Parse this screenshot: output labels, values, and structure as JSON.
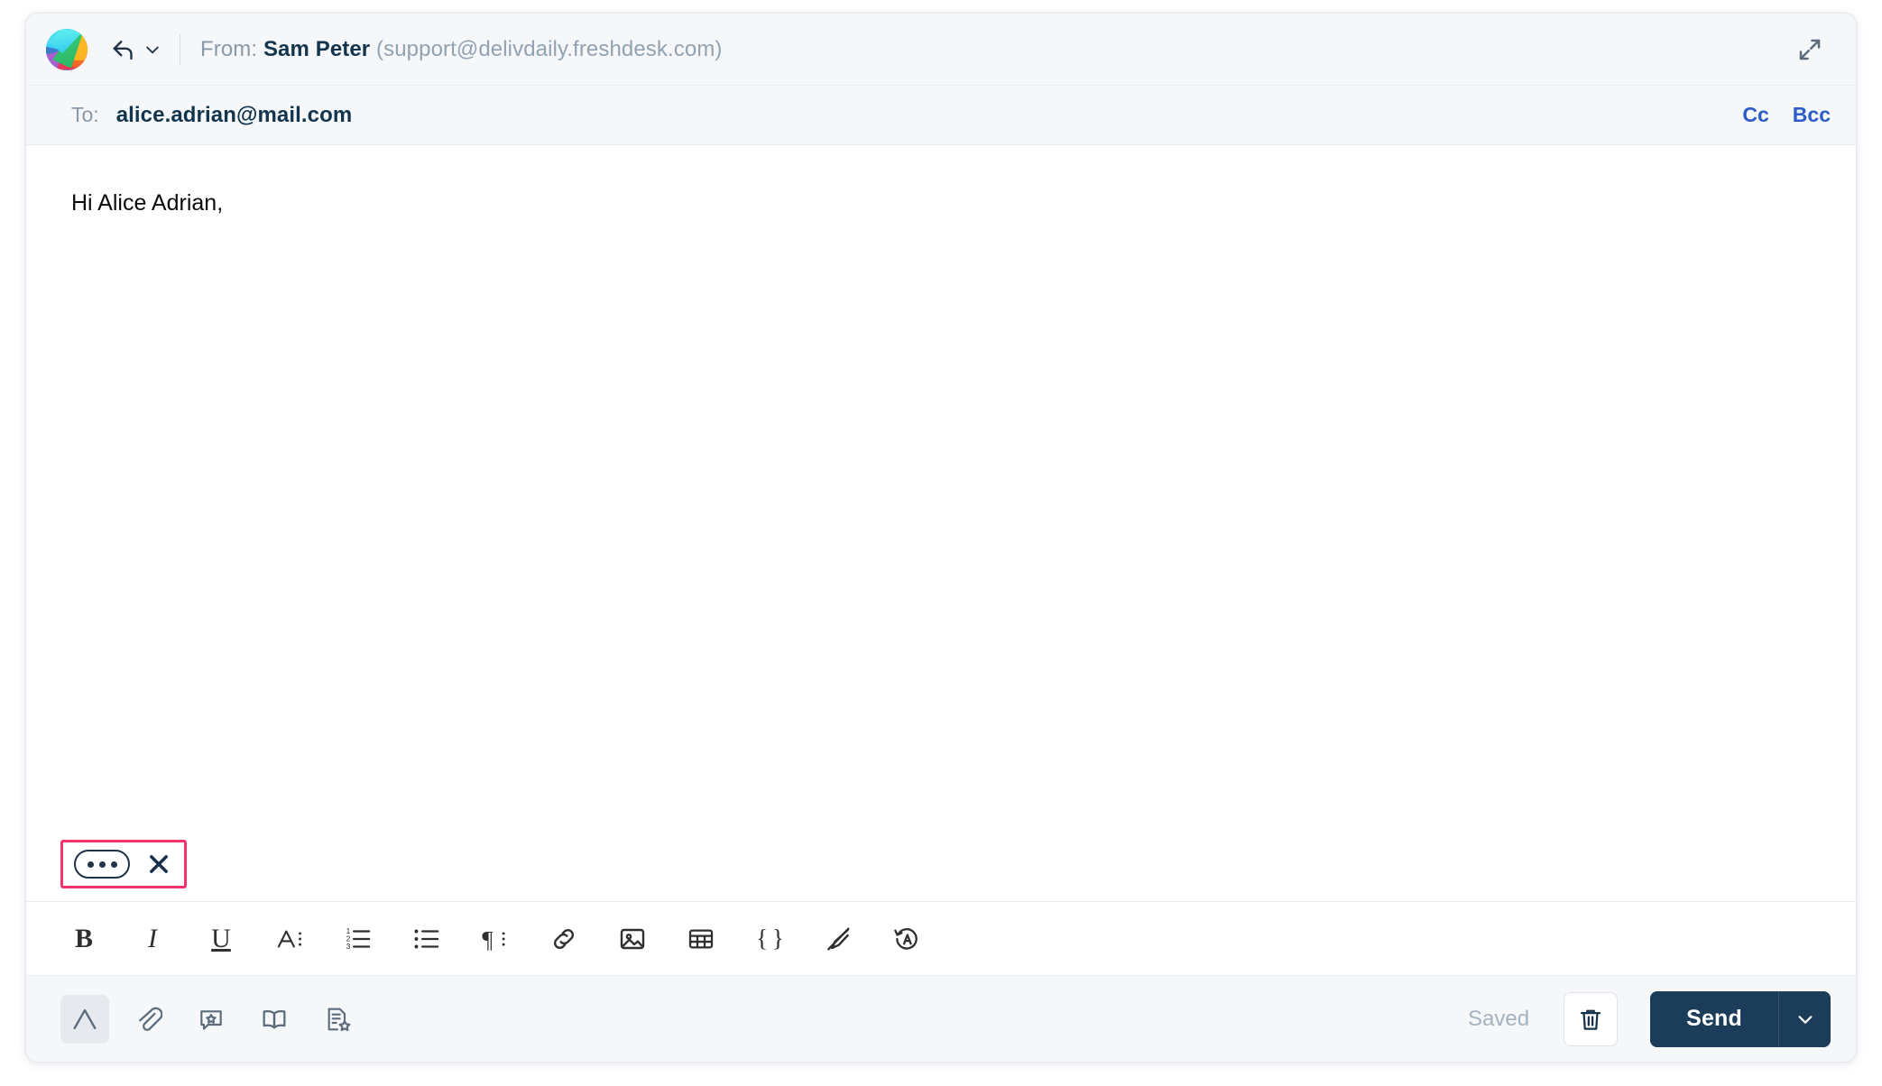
{
  "window": {
    "expand_icon": "expand-diagonal-icon"
  },
  "header": {
    "logo_icon": "freshdesk-logo-icon",
    "reply_icon": "reply-arrow-icon",
    "reply_dropdown_icon": "chevron-down-icon",
    "from_label": "From:",
    "from_name": "Sam Peter",
    "from_email": "(support@delivdaily.freshdesk.com)"
  },
  "recipients": {
    "to_label": "To:",
    "to_value": "alice.adrian@mail.com",
    "cc_label": "Cc",
    "bcc_label": "Bcc",
    "link_color": "#2c5cc5"
  },
  "body": {
    "greeting": "Hi Alice Adrian,",
    "chip": {
      "dots_label": "•••",
      "dots_icon": "ellipsis-pill-icon",
      "close_icon": "close-x-icon",
      "highlight_color": "#f5336c"
    }
  },
  "format_toolbar": {
    "items": [
      {
        "name": "bold-button",
        "glyph": "B",
        "title": "Bold"
      },
      {
        "name": "italic-button",
        "glyph": "I",
        "title": "Italic"
      },
      {
        "name": "underline-button",
        "glyph": "U",
        "title": "Underline"
      },
      {
        "name": "font-style-button",
        "glyph": "A",
        "title": "Font"
      },
      {
        "name": "ordered-list-button",
        "glyph": "",
        "title": "Numbered list"
      },
      {
        "name": "unordered-list-button",
        "glyph": "",
        "title": "Bulleted list"
      },
      {
        "name": "paragraph-button",
        "glyph": "¶",
        "title": "Paragraph"
      },
      {
        "name": "link-button",
        "glyph": "",
        "title": "Insert link"
      },
      {
        "name": "image-button",
        "glyph": "",
        "title": "Insert image"
      },
      {
        "name": "table-button",
        "glyph": "",
        "title": "Insert table"
      },
      {
        "name": "code-button",
        "glyph": "{ }",
        "title": "Code"
      },
      {
        "name": "clear-formatting-button",
        "glyph": "",
        "title": "Clear formatting"
      },
      {
        "name": "spellcheck-button",
        "glyph": "",
        "title": "Spell check"
      }
    ]
  },
  "action_bar": {
    "items": [
      {
        "name": "text-formatting-toggle",
        "title": "Formatting",
        "active": true
      },
      {
        "name": "attach-file-button",
        "title": "Attach file",
        "active": false
      },
      {
        "name": "canned-response-button",
        "title": "Canned response",
        "active": false
      },
      {
        "name": "knowledge-base-button",
        "title": "Knowledge base",
        "active": false
      },
      {
        "name": "template-button",
        "title": "Template",
        "active": false
      }
    ],
    "saved_label": "Saved",
    "delete_icon": "trash-icon",
    "send_label": "Send",
    "send_dropdown_icon": "chevron-down-icon",
    "send_color": "#1c3d5a"
  }
}
